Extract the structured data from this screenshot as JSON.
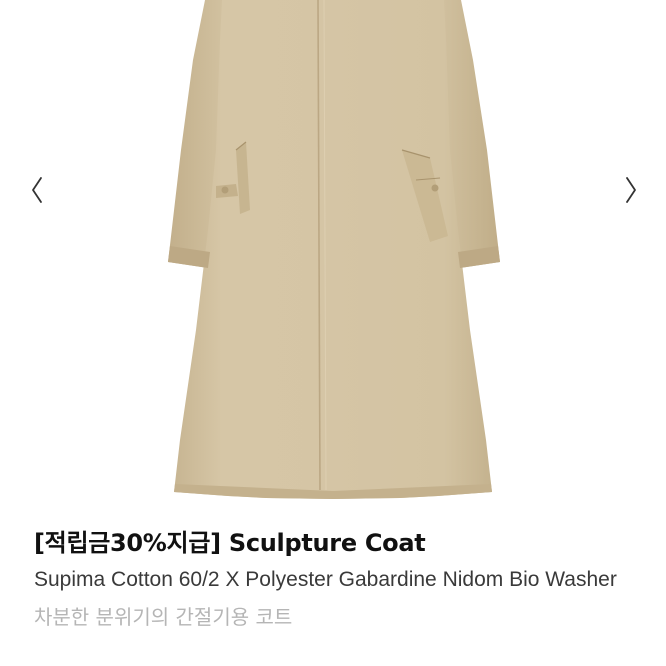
{
  "product": {
    "title": "[적립금30%지급] Sculpture Coat",
    "description": "Supima Cotton 60/2 X Polyester Gabardine Nidom Bio Washer",
    "subtitle": "차분한 분위기의 간절기용 코트",
    "image_alt": "Sculpture Coat",
    "coat_color": "#d3c3a3"
  },
  "gallery": {
    "prev_icon": "chevron-left-icon",
    "next_icon": "chevron-right-icon"
  }
}
